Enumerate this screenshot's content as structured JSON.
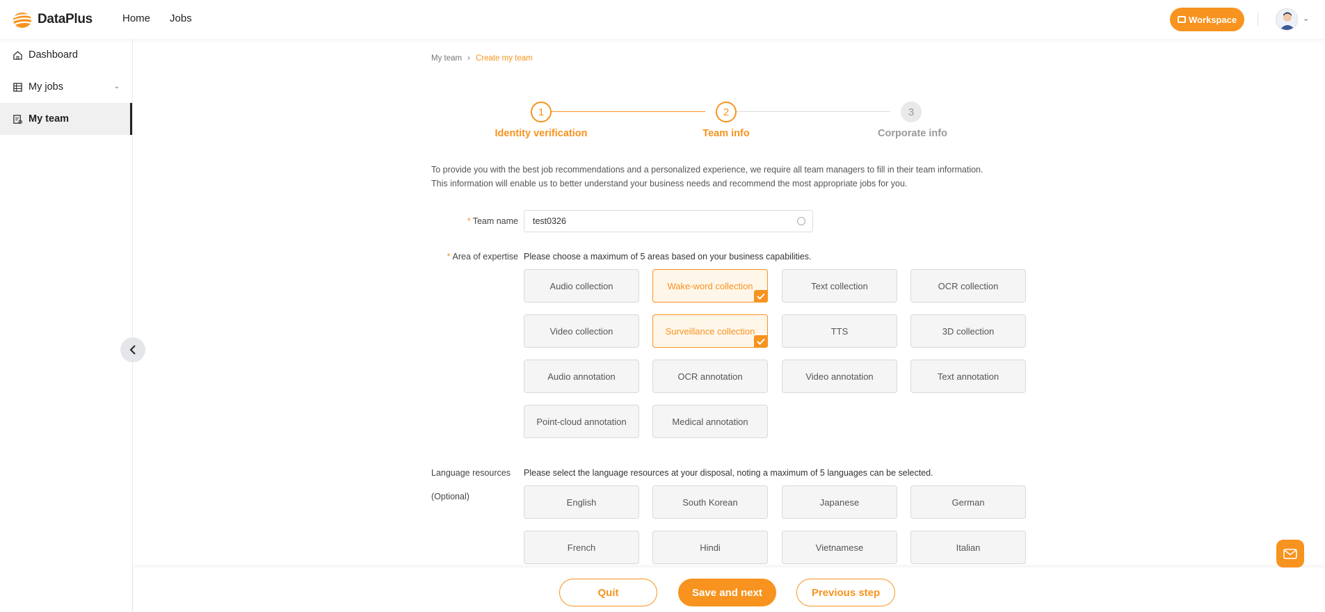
{
  "brand": {
    "name": "DataPlus",
    "accent": "#f7931e"
  },
  "topnav": {
    "items": [
      "Home",
      "Jobs"
    ],
    "workspace_label": "Workspace"
  },
  "sidebar": {
    "items": [
      {
        "label": "Dashboard",
        "icon": "home-icon"
      },
      {
        "label": "My jobs",
        "icon": "jobs-icon",
        "expandable": true
      },
      {
        "label": "My team",
        "icon": "team-icon",
        "active": true
      }
    ]
  },
  "breadcrumb": {
    "parent": "My team",
    "current": "Create my team"
  },
  "stepper": {
    "steps": [
      {
        "number": "1",
        "label": "Identity verification",
        "state": "done"
      },
      {
        "number": "2",
        "label": "Team info",
        "state": "current"
      },
      {
        "number": "3",
        "label": "Corporate info",
        "state": "todo"
      }
    ]
  },
  "intro": {
    "line1": "To provide you with the best job recommendations and a personalized experience, we require all team managers to fill in their team information.",
    "line2": "This information will enable us to better understand your business needs and recommend the most appropriate jobs for you."
  },
  "team_name": {
    "label": "Team name",
    "value": "test0326"
  },
  "expertise": {
    "label": "Area of expertise",
    "hint": "Please choose a maximum of 5 areas based on your business capabilities.",
    "options": [
      {
        "label": "Audio collection",
        "selected": false
      },
      {
        "label": "Wake-word collection",
        "selected": true
      },
      {
        "label": "Text collection",
        "selected": false
      },
      {
        "label": "OCR collection",
        "selected": false
      },
      {
        "label": "Video collection",
        "selected": false
      },
      {
        "label": "Surveillance collection",
        "selected": true
      },
      {
        "label": "TTS",
        "selected": false
      },
      {
        "label": "3D collection",
        "selected": false
      },
      {
        "label": "Audio annotation",
        "selected": false
      },
      {
        "label": "OCR annotation",
        "selected": false
      },
      {
        "label": "Video annotation",
        "selected": false
      },
      {
        "label": "Text annotation",
        "selected": false
      },
      {
        "label": "Point-cloud annotation",
        "selected": false
      },
      {
        "label": "Medical annotation",
        "selected": false
      }
    ]
  },
  "languages": {
    "label": "Language resources",
    "optional": "(Optional)",
    "hint": "Please select the language resources at your disposal, noting a maximum of 5 languages can be selected.",
    "options": [
      {
        "label": "English",
        "selected": false
      },
      {
        "label": "South Korean",
        "selected": false
      },
      {
        "label": "Japanese",
        "selected": false
      },
      {
        "label": "German",
        "selected": false
      },
      {
        "label": "French",
        "selected": false
      },
      {
        "label": "Hindi",
        "selected": false
      },
      {
        "label": "Vietnamese",
        "selected": false
      },
      {
        "label": "Italian",
        "selected": false
      }
    ]
  },
  "footer": {
    "quit": "Quit",
    "save_next": "Save and next",
    "previous": "Previous step"
  }
}
